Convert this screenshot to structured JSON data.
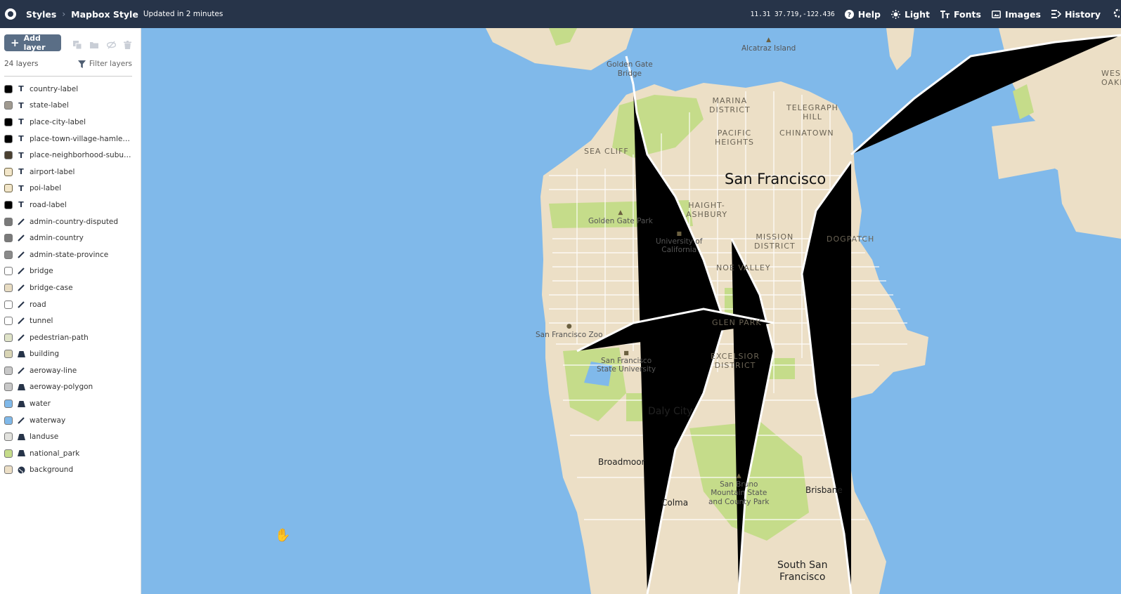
{
  "topbar": {
    "breadcrumb_root": "Styles",
    "style_name": "Mapbox Style",
    "updated": "Updated in 2 minutes",
    "coords": "11.31 37.719,-122.436",
    "buttons": {
      "help": "Help",
      "light": "Light",
      "fonts": "Fonts",
      "images": "Images",
      "history": "History"
    }
  },
  "sidebar": {
    "add_layer": "Add layer",
    "layer_count": "24 layers",
    "filter_layers": "Filter layers",
    "layers": [
      {
        "name": "country-label",
        "type": "symbol",
        "color": "#000000"
      },
      {
        "name": "state-label",
        "type": "symbol",
        "color": "#a09a90"
      },
      {
        "name": "place-city-label",
        "type": "symbol",
        "color": "#000000"
      },
      {
        "name": "place-town-village-hamlet-label",
        "type": "symbol",
        "color": "#000000"
      },
      {
        "name": "place-neighborhood-suburb-l...",
        "type": "symbol",
        "color": "#4a4030"
      },
      {
        "name": "airport-label",
        "type": "symbol-icon",
        "color": "#6b6040"
      },
      {
        "name": "poi-label",
        "type": "symbol-icon",
        "color": "#6b6040"
      },
      {
        "name": "road-label",
        "type": "symbol",
        "color": "#000000"
      },
      {
        "name": "admin-country-disputed",
        "type": "line",
        "color": "#7a7a7a"
      },
      {
        "name": "admin-country",
        "type": "line",
        "color": "#7a7a7a"
      },
      {
        "name": "admin-state-province",
        "type": "line",
        "color": "#8a8a8a"
      },
      {
        "name": "bridge",
        "type": "line",
        "color": "#ffffff"
      },
      {
        "name": "bridge-case",
        "type": "line",
        "color": "#e8dcc2"
      },
      {
        "name": "road",
        "type": "line",
        "color": "#ffffff"
      },
      {
        "name": "tunnel",
        "type": "line",
        "color": "#ffffff"
      },
      {
        "name": "pedestrian-path",
        "type": "line",
        "color": "#dfe3c8"
      },
      {
        "name": "building",
        "type": "fill",
        "color": "#d9d5b5"
      },
      {
        "name": "aeroway-line",
        "type": "line",
        "color": "#c8c8c8"
      },
      {
        "name": "aeroway-polygon",
        "type": "fill",
        "color": "#c8c8c8"
      },
      {
        "name": "water",
        "type": "fill",
        "color": "#80b9ea"
      },
      {
        "name": "waterway",
        "type": "line",
        "color": "#80b9ea"
      },
      {
        "name": "landuse",
        "type": "fill",
        "color": "#e2e2de"
      },
      {
        "name": "national_park",
        "type": "fill",
        "color": "#c5dc8a"
      },
      {
        "name": "background",
        "type": "background",
        "color": "#ecdfc6"
      }
    ]
  },
  "map": {
    "labels": {
      "alcatraz": "Alcatraz Island",
      "golden_gate_bridge_1": "Golden Gate",
      "golden_gate_bridge_2": "Bridge",
      "marina_1": "MARINA",
      "marina_2": "DISTRICT",
      "telegraph_1": "TELEGRAPH",
      "telegraph_2": "HILL",
      "pacific_1": "PACIFIC",
      "pacific_2": "HEIGHTS",
      "chinatown": "CHINATOWN",
      "sea_cliff": "SEA CLIFF",
      "san_francisco": "San Francisco",
      "haight_1": "HAIGHT-",
      "haight_2": "ASHBURY",
      "golden_gate_park": "Golden Gate Park",
      "mission_1": "MISSION",
      "mission_2": "DISTRICT",
      "dogpatch": "DOGPATCH",
      "ucsf_1": "University of",
      "ucsf_2": "California",
      "noe_valley": "NOE VALLEY",
      "glen_park": "GLEN PARK",
      "sf_zoo": "San Francisco Zoo",
      "excelsior_1": "EXCELSIOR",
      "excelsior_2": "DISTRICT",
      "sfsu_1": "San Francisco",
      "sfsu_2": "State University",
      "daly_city": "Daly City",
      "broadmoor": "Broadmoor",
      "san_bruno_1": "San Bruno",
      "san_bruno_2": "Mountain State",
      "san_bruno_3": "and County Park",
      "brisbane": "Brisbane",
      "colma": "Colma",
      "ssf_1": "South San",
      "ssf_2": "Francisco",
      "west_1": "WES",
      "west_2": "OAKLA"
    },
    "colors": {
      "water": "#80b9ea",
      "land": "#ecdfc6",
      "park": "#c5dc8a",
      "road": "#ffffff"
    }
  }
}
